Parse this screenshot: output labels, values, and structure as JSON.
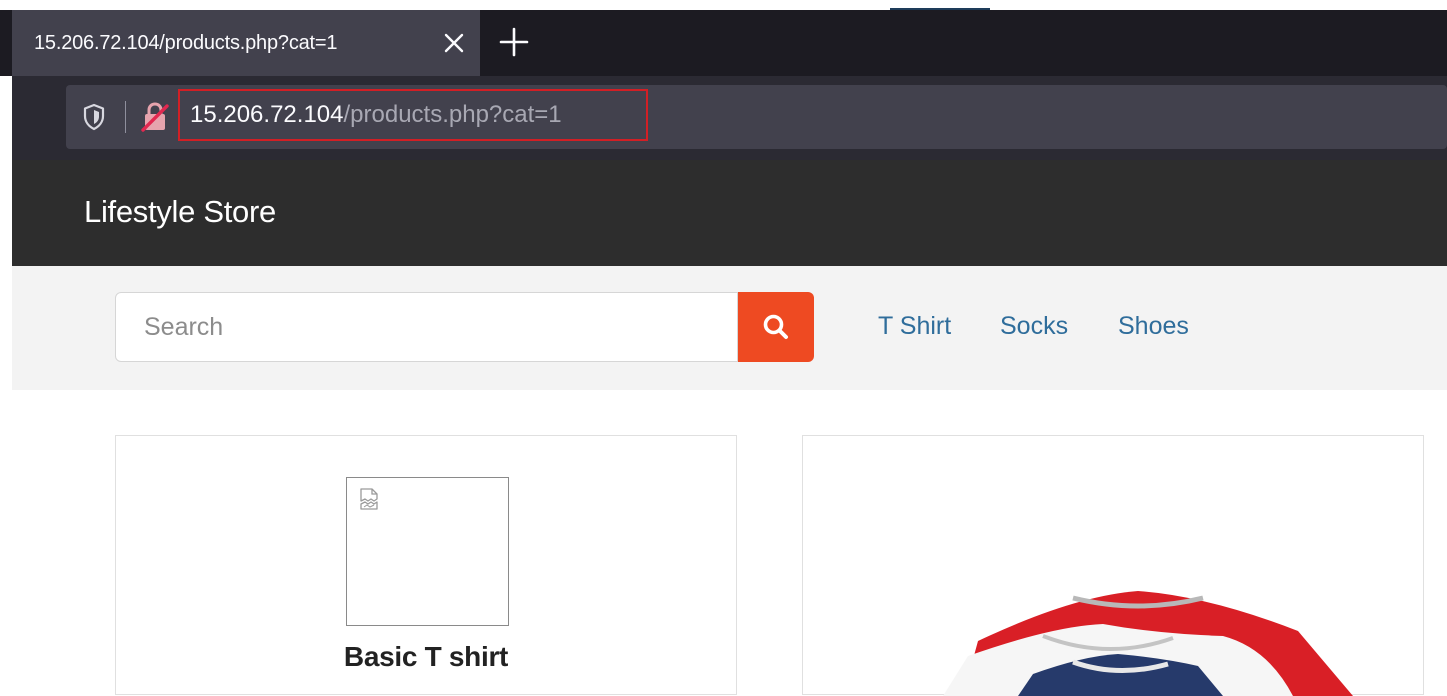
{
  "browser": {
    "tab_title": "15.206.72.104/products.php?cat=1",
    "url_host": "15.206.72.104",
    "url_path": "/products.php?cat=1"
  },
  "site": {
    "brand": "Lifestyle Store",
    "search_placeholder": "Search",
    "categories": [
      "T Shirt",
      "Socks",
      "Shoes"
    ]
  },
  "products": [
    {
      "name": "Basic T shirt",
      "image": "broken-image-icon"
    },
    {
      "name": "",
      "image": "tshirt-stack"
    }
  ],
  "colors": {
    "accent": "#ee4a22",
    "link": "#2f6d9b",
    "header": "#2d2d2d",
    "url_highlight": "#d21f25"
  }
}
